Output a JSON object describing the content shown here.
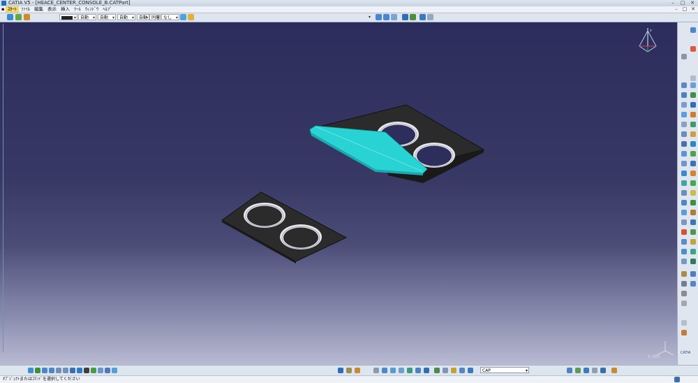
{
  "window": {
    "title": "CATIA V5 - [HEACE_CENTER_CONSOLE_B.CATPart]",
    "buttons": [
      "–",
      "□",
      "✕"
    ]
  },
  "menubar": {
    "items": [
      {
        "label": "ｽﾀｰﾄ",
        "active": true
      },
      {
        "label": "ﾌｧｲﾙ"
      },
      {
        "label": "編集"
      },
      {
        "label": "表示"
      },
      {
        "label": "挿入"
      },
      {
        "label": "ﾂｰﾙ"
      },
      {
        "label": "ｳｨﾝﾄﾞｳ"
      },
      {
        "label": "ﾍﾙﾌﾟ"
      }
    ],
    "mdi_buttons": [
      "–",
      "□",
      "✕"
    ]
  },
  "toolbar": {
    "dropdowns": [
      "自動",
      "自動",
      "自動",
      "自動",
      "同層",
      "同層",
      "なし"
    ]
  },
  "viewport": {
    "accent_color": "#2ad3d3",
    "plate_color": "#2a2a2a",
    "scale_label": "0.483"
  },
  "bottombar": {
    "command_value": "CAP"
  },
  "statusbar": {
    "message": "ｵﾌﾞｼﾞｪｸﾄまたはｺﾏﾝﾄﾞを選択してください"
  },
  "compass": {
    "label": "z"
  },
  "catia_logo": "CATIA"
}
